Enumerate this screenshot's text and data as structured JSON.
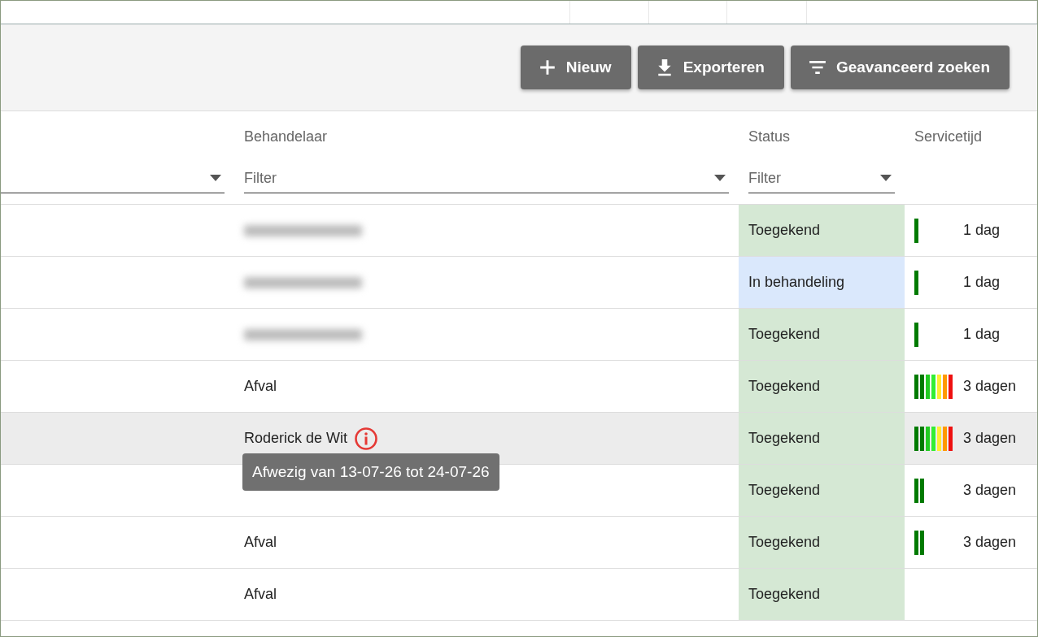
{
  "toolbar": {
    "buttons": [
      {
        "kind": "add",
        "label": "Nieuw"
      },
      {
        "kind": "export",
        "label": "Exporteren"
      },
      {
        "kind": "filter",
        "label": "Geavanceerd zoeken"
      }
    ]
  },
  "table": {
    "columns": [
      {
        "kind": "filter"
      },
      {
        "kind": "filter",
        "label": "Behandelaar",
        "filter": "Filter"
      },
      {
        "kind": "filter",
        "label": "Status",
        "filter": "Filter"
      },
      {
        "kind": "plain",
        "label": "Servicetijd"
      }
    ],
    "rows": [
      {
        "highlighted": false,
        "handler": {
          "kind": "redacted"
        },
        "status": {
          "text": "Toegekend",
          "color": "#d5e8d4"
        },
        "service": {
          "segments": [
            {
              "color": "#007a00"
            }
          ],
          "text": "1 dag"
        }
      },
      {
        "highlighted": false,
        "handler": {
          "kind": "redacted"
        },
        "status": {
          "text": "In behandeling",
          "color": "#dae8fc"
        },
        "service": {
          "segments": [
            {
              "color": "#007a00"
            }
          ],
          "text": "1 dag"
        }
      },
      {
        "highlighted": false,
        "handler": {
          "kind": "redacted"
        },
        "status": {
          "text": "Toegekend",
          "color": "#d5e8d4"
        },
        "service": {
          "segments": [
            {
              "color": "#007a00"
            }
          ],
          "text": "1 dag"
        }
      },
      {
        "highlighted": false,
        "handler": {
          "kind": "text",
          "text": "Afval"
        },
        "status": {
          "text": "Toegekend",
          "color": "#d5e8d4"
        },
        "service": {
          "segments": [
            {
              "color": "#007a00"
            },
            {
              "color": "#007a00"
            },
            {
              "color": "#22cc22"
            },
            {
              "color": "#33ee33"
            },
            {
              "color": "#ffee33"
            },
            {
              "color": "#ff9900"
            },
            {
              "color": "#ee1111"
            }
          ],
          "text": "3 dagen"
        }
      },
      {
        "highlighted": true,
        "handler": {
          "kind": "text",
          "text": "Roderick de Wit",
          "info": true,
          "tooltip": "Afwezig van 13-07-26 tot 24-07-26"
        },
        "status": {
          "text": "Toegekend",
          "color": "#d5e8d4"
        },
        "service": {
          "segments": [
            {
              "color": "#007a00"
            },
            {
              "color": "#007a00"
            },
            {
              "color": "#22cc22"
            },
            {
              "color": "#33ee33"
            },
            {
              "color": "#ffee33"
            },
            {
              "color": "#ff9900"
            },
            {
              "color": "#ee1111"
            }
          ],
          "text": "3 dagen"
        }
      },
      {
        "highlighted": false,
        "handler": {
          "kind": "covered"
        },
        "status": {
          "text": "Toegekend",
          "color": "#d5e8d4"
        },
        "service": {
          "segments": [
            {
              "color": "#007a00"
            },
            {
              "color": "#007a00"
            }
          ],
          "text": "3 dagen"
        }
      },
      {
        "highlighted": false,
        "handler": {
          "kind": "text",
          "text": "Afval"
        },
        "status": {
          "text": "Toegekend",
          "color": "#d5e8d4"
        },
        "service": {
          "segments": [
            {
              "color": "#007a00"
            },
            {
              "color": "#007a00"
            }
          ],
          "text": "3 dagen"
        }
      },
      {
        "highlighted": false,
        "handler": {
          "kind": "text",
          "text": "Afval"
        },
        "status": {
          "text": "Toegekend",
          "color": "#d5e8d4"
        }
      }
    ]
  }
}
